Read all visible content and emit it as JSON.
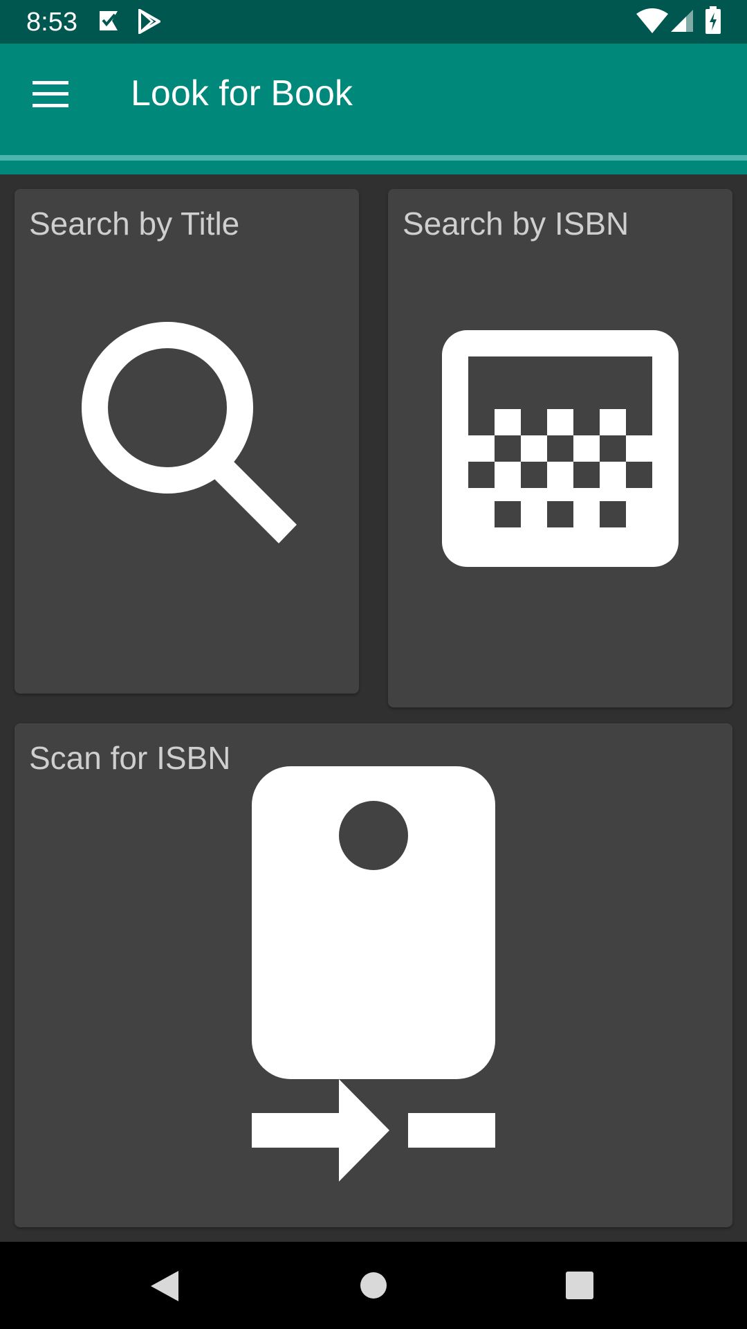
{
  "status_bar": {
    "time": "8:53",
    "icons": [
      "notification-check-icon",
      "play-store-icon",
      "wifi-icon",
      "cell-signal-icon",
      "battery-charging-icon"
    ]
  },
  "app_bar": {
    "title": "Look for Book",
    "menu_icon": "hamburger-menu-icon",
    "background": "#00897b"
  },
  "cards": {
    "search_title": {
      "label": "Search by Title",
      "icon": "magnifier-icon"
    },
    "search_isbn": {
      "label": "Search by ISBN",
      "icon": "barcode-keyboard-icon"
    },
    "scan_isbn": {
      "label": "Scan for ISBN",
      "icon": "scanner-device-icon"
    }
  },
  "nav_bar": {
    "buttons": [
      "back-icon",
      "home-icon",
      "recents-icon"
    ]
  },
  "colors": {
    "status_bar": "#00574f",
    "accent": "#4db6ac",
    "card": "#424242",
    "background": "#303030"
  }
}
